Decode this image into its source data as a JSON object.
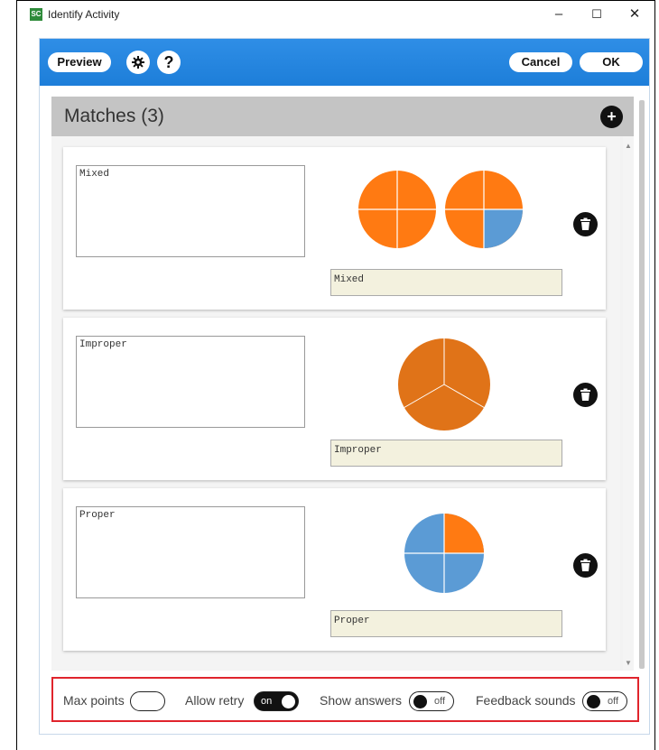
{
  "window": {
    "title": "Identify Activity",
    "app_icon_text": "SC",
    "controls": {
      "minimize": "–",
      "maximize": "☐",
      "close": "✕"
    }
  },
  "toolbar": {
    "preview_label": "Preview",
    "settings_icon": "gear-icon",
    "help_label": "?",
    "cancel_label": "Cancel",
    "ok_label": "OK"
  },
  "section": {
    "title": "Matches (3)",
    "add_label": "+"
  },
  "matches": [
    {
      "answer": "Mixed",
      "label": "Mixed",
      "image": "two pie charts: full orange circle and circle with 3 of 4 quarters orange, 1 quarter blue"
    },
    {
      "answer": "Improper",
      "label": "Improper",
      "image": "circle divided into 3 orange thirds"
    },
    {
      "answer": "Proper",
      "label": "Proper",
      "image": "circle with 1 of 4 quarters orange, 3 blue"
    }
  ],
  "footer": {
    "max_points_label": "Max points",
    "allow_retry_label": "Allow retry",
    "allow_retry_state": "on",
    "show_answers_label": "Show answers",
    "show_answers_state": "off",
    "feedback_sounds_label": "Feedback sounds",
    "feedback_sounds_state": "off"
  },
  "colors": {
    "accent_blue": "#1d7ed9",
    "orange": "#ff7a12",
    "dark_orange": "#e07318",
    "pie_blue": "#5b9bd5",
    "highlight_red": "#e0242c",
    "label_bg": "#f3f1de"
  }
}
